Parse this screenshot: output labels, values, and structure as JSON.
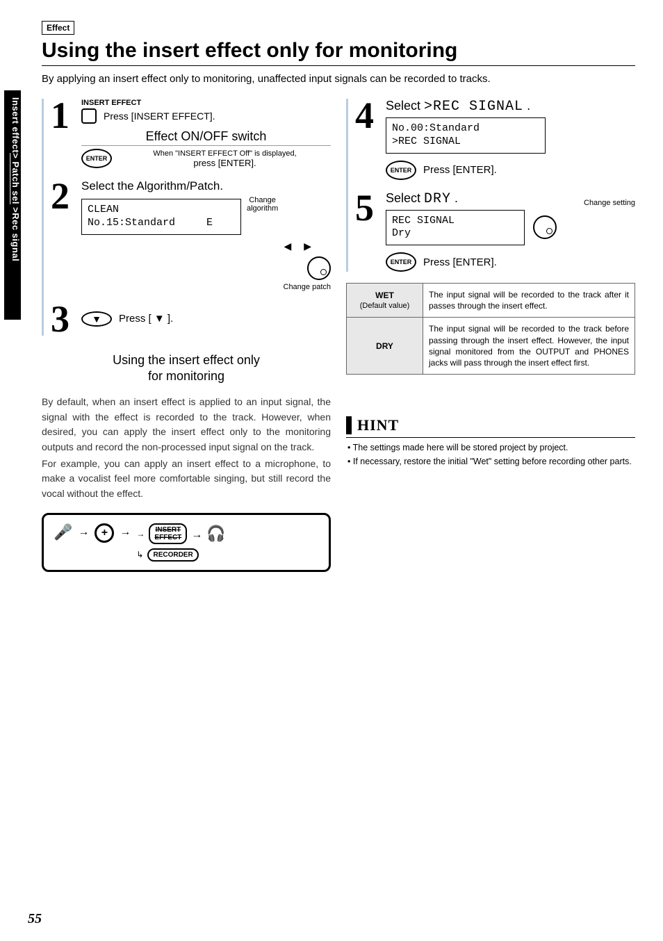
{
  "sidebar": {
    "line1": "Insert effect",
    "line2_underline": "> Patch sel",
    "line3": " >Rec signal"
  },
  "header": {
    "category": "Effect",
    "title": "Using the insert effect only for monitoring",
    "intro": "By applying an insert effect only to monitoring, unaffected input signals can be recorded to tracks."
  },
  "steps": {
    "s1": {
      "num": "1",
      "labelTop": "INSERT EFFECT",
      "text": "Press [INSERT EFFECT].",
      "subtitle": "Effect ON/OFF switch",
      "tiny1": "When \"INSERT EFFECT Off\" is displayed,",
      "tiny2": "press [ENTER]."
    },
    "s2": {
      "num": "2",
      "text": "Select the Algorithm/Patch.",
      "lcd": "CLEAN\nNo.15:Standard     E",
      "chgAlg": "Change\nalgorithm",
      "chgPatch": "Change patch"
    },
    "s3": {
      "num": "3",
      "text": "Press [ ▼ ]."
    },
    "s4": {
      "num": "4",
      "text_a": "Select ",
      "text_b": ">REC SIGNAL",
      "text_c": " .",
      "lcd": "No.00:Standard\n>REC SIGNAL",
      "press": "Press [ENTER]."
    },
    "s5": {
      "num": "5",
      "text_a": "Select ",
      "text_b": "DRY",
      "text_c": " .",
      "chg": "Change setting",
      "lcd": "REC SIGNAL\nDry",
      "press": "Press [ENTER]."
    }
  },
  "table": {
    "wet_h1": "WET",
    "wet_h2": "(Default value)",
    "wet_d": "The input signal will be recorded to the track after it passes through the insert effect.",
    "dry_h": "DRY",
    "dry_d": "The input signal will be recorded to the track before passing through the insert effect. However, the input signal monitored from the OUTPUT and PHONES jacks will pass through the insert effect first."
  },
  "note": {
    "title1": "Using the insert effect only",
    "title2": "for monitoring",
    "p1": "By default, when an insert effect is applied to an input signal, the signal with the effect is recorded to the track. However, when desired, you can apply the insert effect only to the monitoring outputs and record the non-processed input signal on the track.",
    "p2": "For example, you can apply an insert effect to a microphone, to make a vocalist feel more comfortable singing, but still record the vocal without the effect."
  },
  "flow": {
    "insert": "INSERT\nEFFECT",
    "recorder": "RECORDER"
  },
  "hint": {
    "title": "HINT",
    "b1": "The settings made here will be stored project by project.",
    "b2": "If necessary, restore the initial \"Wet\" setting before recording other parts."
  },
  "pageNumber": "55"
}
